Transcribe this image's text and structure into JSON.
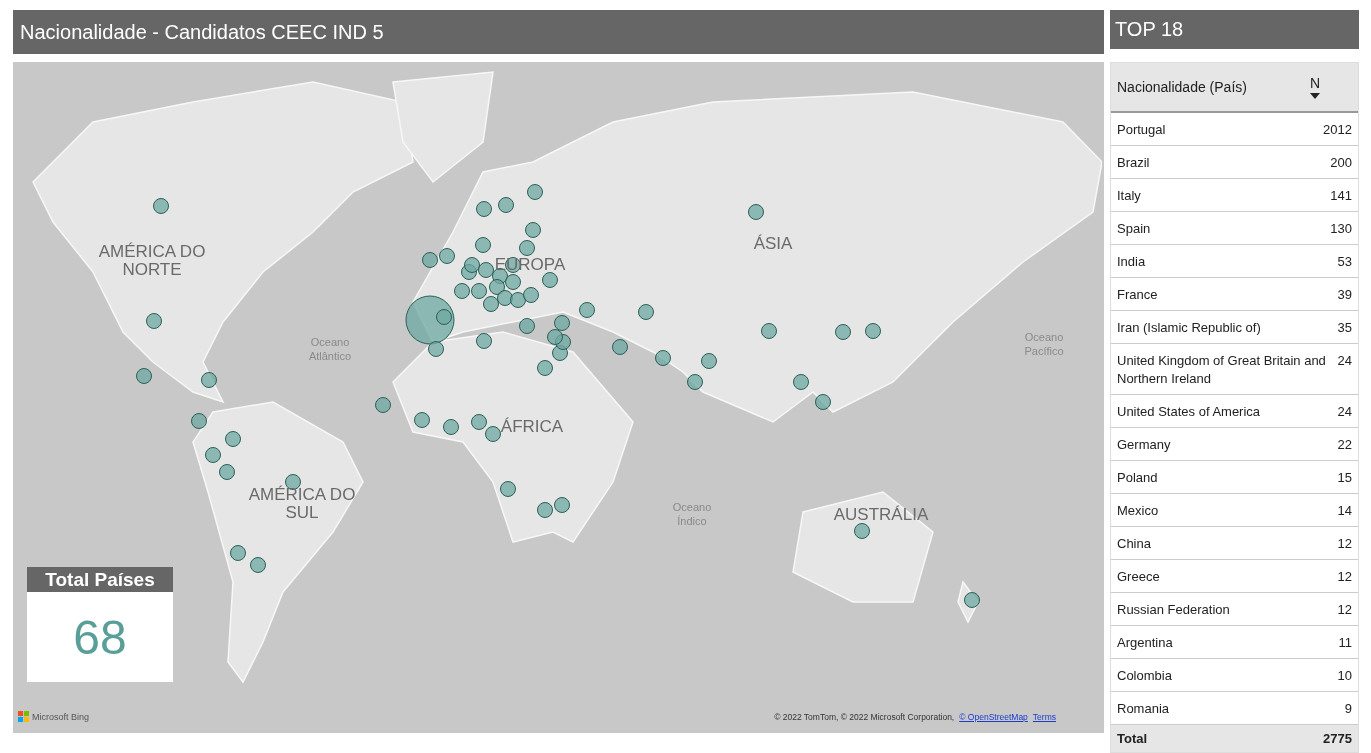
{
  "title": "Nacionalidade - Candidatos CEEC IND 5",
  "map": {
    "labels": [
      {
        "text": "AMÉRICA DO NORTE",
        "kind": "continent"
      },
      {
        "text": "EUROPA",
        "kind": "continent"
      },
      {
        "text": "ÁSIA",
        "kind": "continent"
      },
      {
        "text": "Oceano Atlântico",
        "kind": "ocean"
      },
      {
        "text": "Oceano Pacífico",
        "kind": "ocean"
      },
      {
        "text": "ÁFRICA",
        "kind": "continent"
      },
      {
        "text": "AMÉRICA DO SUL",
        "kind": "continent"
      },
      {
        "text": "Oceano Índico",
        "kind": "ocean"
      },
      {
        "text": "AUSTRÁLIA",
        "kind": "continent"
      }
    ],
    "total_card": {
      "label": "Total Países",
      "value": "68"
    },
    "logo": "Microsoft Bing",
    "attribution": {
      "text": "© 2022 TomTom, © 2022 Microsoft Corporation,",
      "links": [
        "© OpenStreetMap",
        "Terms"
      ]
    }
  },
  "top": {
    "title": "TOP 18",
    "columns": [
      "Nacionalidade (País)",
      "N"
    ],
    "rows": [
      {
        "name": "Portugal",
        "n": "2012"
      },
      {
        "name": "Brazil",
        "n": "200"
      },
      {
        "name": "Italy",
        "n": "141"
      },
      {
        "name": "Spain",
        "n": "130"
      },
      {
        "name": "India",
        "n": "53"
      },
      {
        "name": "France",
        "n": "39"
      },
      {
        "name": "Iran (Islamic Republic of)",
        "n": "35"
      },
      {
        "name": "United Kingdom of Great Britain and Northern Ireland",
        "n": "24"
      },
      {
        "name": "United States of America",
        "n": "24"
      },
      {
        "name": "Germany",
        "n": "22"
      },
      {
        "name": "Poland",
        "n": "15"
      },
      {
        "name": "Mexico",
        "n": "14"
      },
      {
        "name": "China",
        "n": "12"
      },
      {
        "name": "Greece",
        "n": "12"
      },
      {
        "name": "Russian Federation",
        "n": "12"
      },
      {
        "name": "Argentina",
        "n": "11"
      },
      {
        "name": "Colombia",
        "n": "10"
      },
      {
        "name": "Romania",
        "n": "9"
      }
    ],
    "total": {
      "label": "Total",
      "value": "2775"
    }
  }
}
